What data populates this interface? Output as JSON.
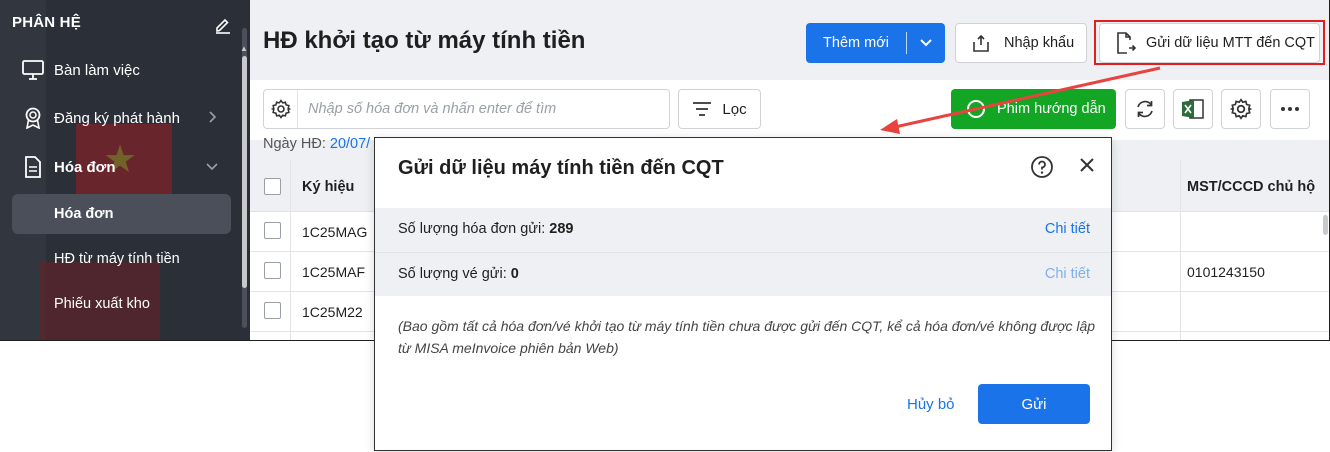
{
  "sidebar": {
    "header": "PHÂN HỆ",
    "items": [
      {
        "label": "Bàn làm việc",
        "icon": "monitor-icon"
      },
      {
        "label": "Đăng ký phát hành",
        "icon": "award-icon"
      },
      {
        "label": "Hóa đơn",
        "icon": "document-icon"
      }
    ],
    "subitems": [
      {
        "label": "Hóa đơn",
        "active": true
      },
      {
        "label": "HĐ từ máy tính tiền",
        "active": false
      },
      {
        "label": "Phiếu xuất kho",
        "active": false
      }
    ]
  },
  "header": {
    "title": "HĐ khởi tạo từ máy tính tiền",
    "add_label": "Thêm mới",
    "import_label": "Nhập khẩu",
    "send_label": "Gửi dữ liệu MTT đến CQT"
  },
  "toolbar": {
    "search_placeholder": "Nhập số hóa đơn và nhấn enter để tìm",
    "filter_label": "Lọc",
    "guide_label": "Phim hướng dẫn",
    "date_label": "Ngày HĐ:",
    "date_value": "20/07/"
  },
  "grid": {
    "columns": [
      "Ký hiệu",
      "MST/CCCD chủ hộ"
    ],
    "rows": [
      {
        "code": "1C25MAG",
        "mst": ""
      },
      {
        "code": "1C25MAF",
        "mst": "0101243150"
      },
      {
        "code": "1C25M22",
        "mst": ""
      }
    ]
  },
  "dialog": {
    "title": "Gửi dữ liệu máy tính tiền đến CQT",
    "invoice_count_label": "Số lượng hóa đơn gửi:",
    "invoice_count": "289",
    "ticket_count_label": "Số lượng vé gửi:",
    "ticket_count": "0",
    "detail_label": "Chi tiết",
    "note": "(Bao gồm tất cả hóa đơn/vé khởi tạo từ máy tính tiền chưa được gửi đến CQT, kể cả hóa đơn/vé không được lập từ MISA meInvoice phiên bản Web)",
    "cancel_label": "Hủy bỏ",
    "send_label": "Gửi"
  },
  "colors": {
    "primary": "#1a73e8",
    "success": "#13a524",
    "highlight": "#e02020",
    "sidebar_bg": "#2b2f38"
  }
}
